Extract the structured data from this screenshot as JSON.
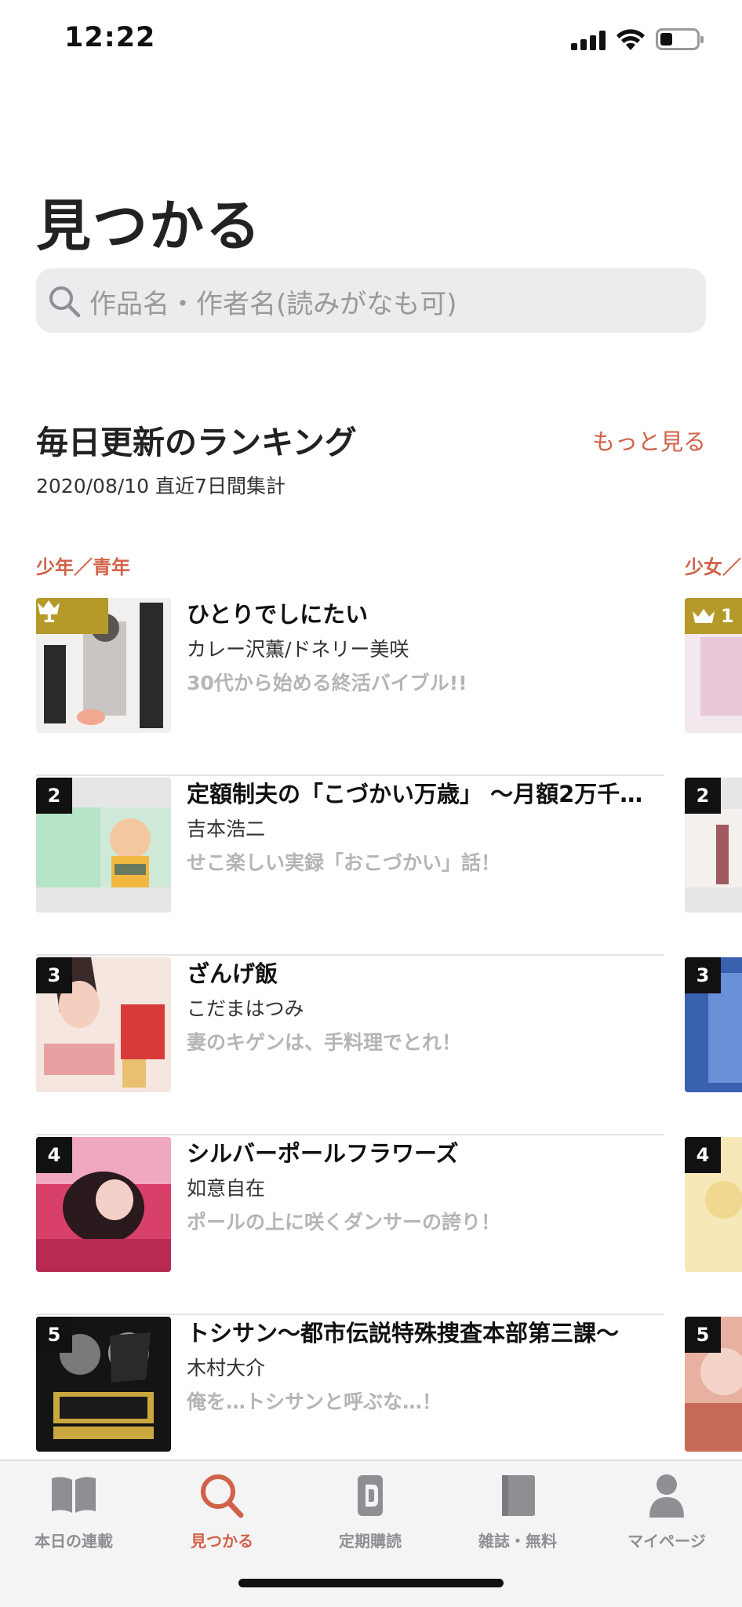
{
  "status": {
    "time": "12:22",
    "battery_level": 0.35
  },
  "header": {
    "title": "見つかる",
    "search_placeholder": "作品名・作者名(読みがなも可)"
  },
  "ranking": {
    "title": "毎日更新のランキング",
    "more_label": "もっと見る",
    "subtitle": "2020/08/10 直近7日間集計",
    "categories": [
      "少年／青年",
      "少女／"
    ],
    "items": [
      {
        "rank": "1",
        "title": "ひとりでしにたい",
        "author": "カレー沢薫/ドネリー美咲",
        "desc": "30代から始める終活バイブル!!"
      },
      {
        "rank": "2",
        "title": "定額制夫の「こづかい万歳」 〜月額2万千…",
        "author": "吉本浩二",
        "desc": "せこ楽しい実録「おこづかい」話！"
      },
      {
        "rank": "3",
        "title": "ざんげ飯",
        "author": "こだまはつみ",
        "desc": "妻のキゲンは、手料理でとれ！"
      },
      {
        "rank": "4",
        "title": "シルバーポールフラワーズ",
        "author": "如意自在",
        "desc": "ポールの上に咲くダンサーの誇り！"
      },
      {
        "rank": "5",
        "title": "トシサン〜都市伝説特殊捜査本部第三課〜",
        "author": "木村大介",
        "desc": "俺を…トシサンと呼ぶな…！"
      }
    ],
    "side_ranks": [
      "1",
      "2",
      "3",
      "4",
      "5"
    ]
  },
  "tabs": [
    {
      "label": "本日の連載",
      "icon": "book-open-icon",
      "active": false
    },
    {
      "label": "見つかる",
      "icon": "search-icon",
      "active": true
    },
    {
      "label": "定期購読",
      "icon": "subscription-icon",
      "active": false
    },
    {
      "label": "雑誌・無料",
      "icon": "magazine-icon",
      "active": false
    },
    {
      "label": "マイページ",
      "icon": "person-icon",
      "active": false
    }
  ],
  "colors": {
    "accent": "#d2614a",
    "gold": "#b59a2a",
    "inactive": "#8e8e93"
  }
}
